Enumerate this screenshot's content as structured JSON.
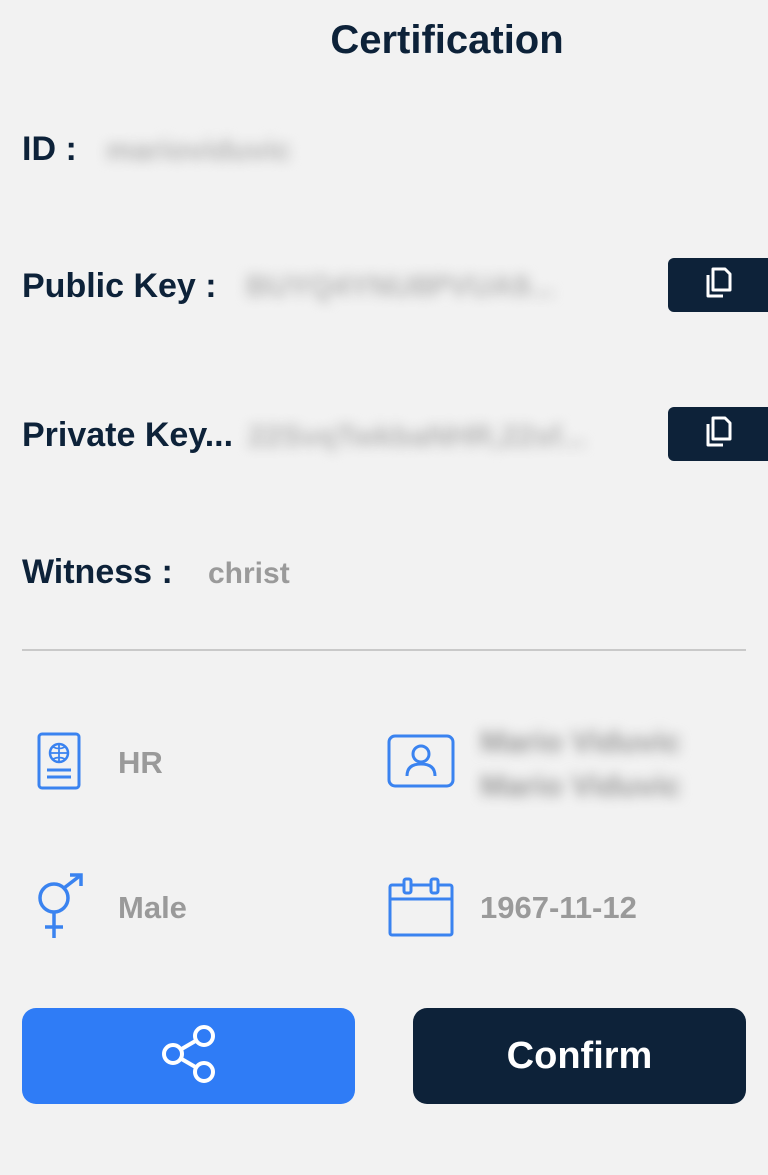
{
  "header": {
    "title": "Certification"
  },
  "fields": {
    "id": {
      "label": "ID :",
      "value": "marioviduvic"
    },
    "public_key": {
      "label": "Public Key  :",
      "value": "BUYQ4YNU8PVUA9..."
    },
    "private_key": {
      "label": "Private Key...",
      "value": "22SvqTwkbaNHR,22sf..."
    },
    "witness": {
      "label": "Witness :",
      "value": "christ"
    }
  },
  "info": {
    "country": "HR",
    "name_line1": "Mario Viduvic",
    "name_line2": "Mario Viduvic",
    "gender": "Male",
    "birth_date": "1967-11-12"
  },
  "buttons": {
    "confirm_label": "Confirm"
  },
  "icons": {
    "passport": "passport-icon",
    "person_card": "person-card-icon",
    "gender": "gender-icon",
    "calendar": "calendar-icon",
    "copy": "copy-icon",
    "share": "share-icon"
  },
  "colors": {
    "primary_dark": "#0d2239",
    "accent_blue": "#2f7cf6",
    "icon_blue": "#3a83f0",
    "muted_text": "#9a9a9a",
    "background": "#f2f2f2"
  }
}
